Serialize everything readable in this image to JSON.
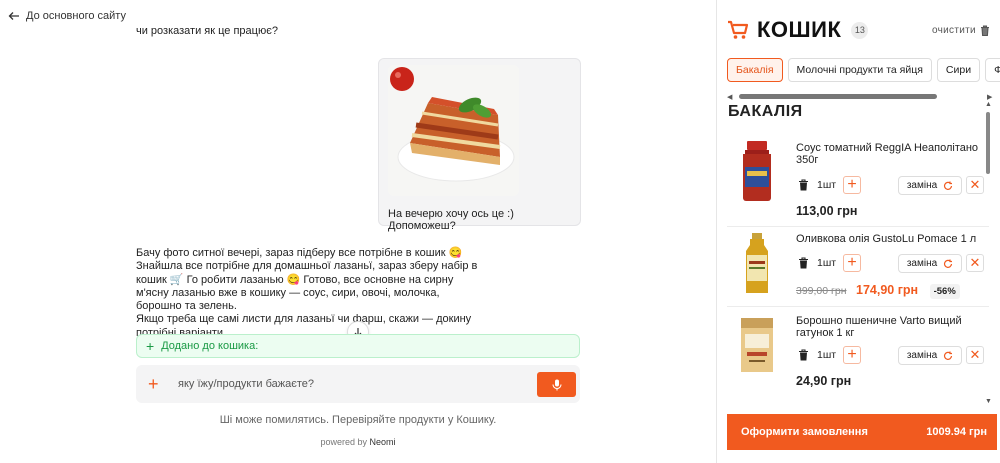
{
  "nav": {
    "back_label": "До основного сайту"
  },
  "chat": {
    "user_question": "чи розказати як це працює?",
    "user_message": "На вечерю хочу ось це :) Допоможеш?",
    "bot_message": "Бачу фото ситної вечері, зараз підберу все потрібне в кошик 😋 Знайшла все потрібне для домашньої лазаньї, зараз зберу набір в кошик 🛒 Го робити лазанью 😋 Готово, все основне на сирну м'ясну лазанью вже в кошику — соус, сири, овочі, молочка, борошно та зелень.\nЯкщо треба ще самі листи для лазаньї чи фарш, скажи — докину потрібні варіанти.",
    "added_notice": "Додано до кошика:",
    "input_placeholder": "яку їжу/продукти бажаєте?",
    "disclaimer": "Ші може помилятись. Перевіряйте продукти у Кошику.",
    "powered_prefix": "powered by",
    "powered_brand": "Neomi"
  },
  "cart": {
    "title": "КОШИК",
    "count": "13",
    "clear_label": "очистити",
    "tabs": [
      {
        "label": "Бакалія",
        "active": true
      },
      {
        "label": "Молочні продукти та яйця",
        "active": false
      },
      {
        "label": "Сири",
        "active": false
      },
      {
        "label": "Фрукти",
        "active": false
      }
    ],
    "category_title": "БАКАЛІЯ",
    "replace_label": "заміна",
    "items": [
      {
        "name": "Соус томатний ReggIA Неаполітано 350г",
        "qty": "1шт",
        "price": "113,00 грн"
      },
      {
        "name": "Оливкова олія GustoLu Pomace 1 л",
        "qty": "1шт",
        "old_price": "399,00 грн",
        "price": "174,90 грн",
        "discount": "-56%"
      },
      {
        "name": "Борошно пшеничне Varto вищий гатунок 1 кг",
        "qty": "1шт",
        "price": "24,90 грн"
      }
    ],
    "order_label": "Оформити замовлення",
    "order_total": "1009.94 грн"
  },
  "colors": {
    "accent": "#f15a1f",
    "success": "#1a9a45"
  },
  "icons": [
    "arrow-left-icon",
    "cart-icon",
    "trash-icon",
    "plus-icon",
    "refresh-icon",
    "close-icon",
    "mic-icon",
    "arrow-down-icon"
  ]
}
